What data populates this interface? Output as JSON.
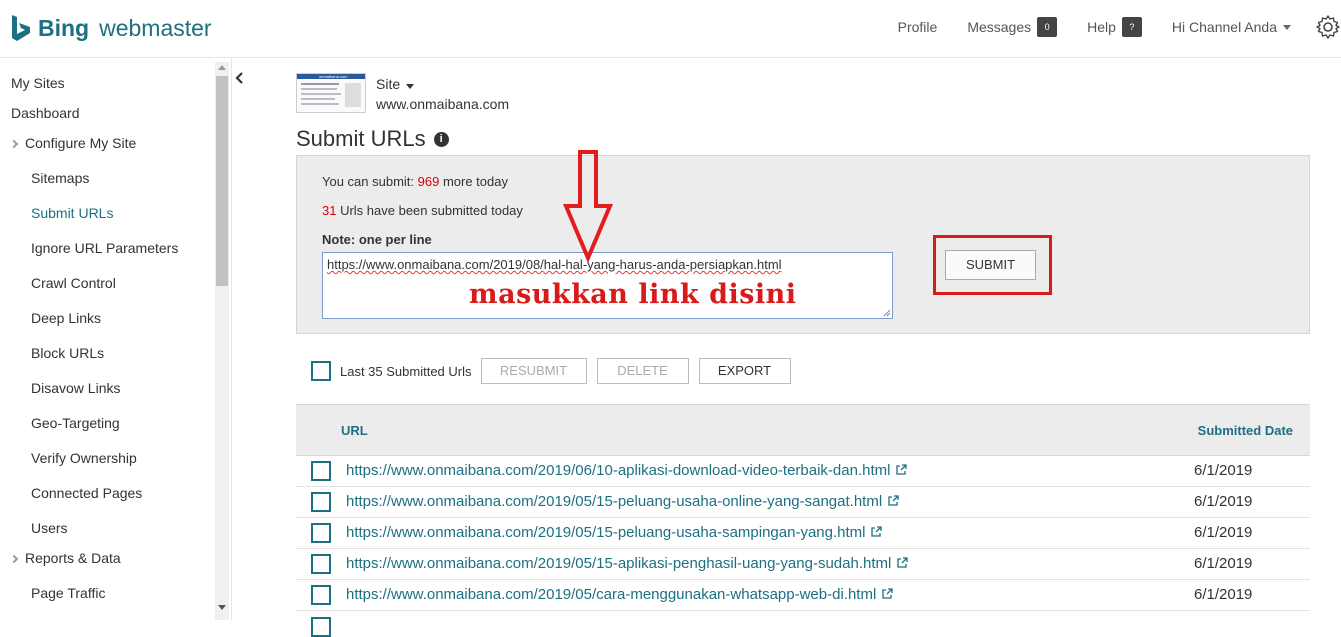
{
  "header": {
    "brand_bing": "Bing",
    "brand_product": "webmaster",
    "nav": {
      "profile": "Profile",
      "messages": "Messages",
      "messages_count": "0",
      "help": "Help",
      "help_badge": "?",
      "user": "Hi Channel Anda"
    }
  },
  "sidebar": {
    "items": [
      {
        "label": "My Sites"
      },
      {
        "label": "Dashboard"
      },
      {
        "label": "Configure My Site"
      },
      {
        "label": "Sitemaps"
      },
      {
        "label": "Submit URLs"
      },
      {
        "label": "Ignore URL Parameters"
      },
      {
        "label": "Crawl Control"
      },
      {
        "label": "Deep Links"
      },
      {
        "label": "Block URLs"
      },
      {
        "label": "Disavow Links"
      },
      {
        "label": "Geo-Targeting"
      },
      {
        "label": "Verify Ownership"
      },
      {
        "label": "Connected Pages"
      },
      {
        "label": "Users"
      },
      {
        "label": "Reports & Data"
      },
      {
        "label": "Page Traffic"
      }
    ],
    "active": "Submit URLs"
  },
  "site": {
    "label": "Site",
    "url": "www.onmaibana.com",
    "thumbnail_title": "onmaibana.com"
  },
  "page": {
    "title": "Submit URLs",
    "info_icon": "i"
  },
  "submit_panel": {
    "quota_prefix": "You can submit: ",
    "quota_value": "969",
    "quota_suffix": " more today",
    "submitted_value": "31",
    "submitted_suffix": " Urls have been submitted today",
    "note": "Note: one per line",
    "url_prefix": "https://www.onmaibana.com/2019/08/",
    "url_rest": "hal-hal-yang-harus-anda-persiapkan.html",
    "hint": "masukkan link disini",
    "submit_label": "SUBMIT"
  },
  "list_actions": {
    "select_all_label": "Last 35 Submitted Urls",
    "resubmit": "RESUBMIT",
    "delete": "DELETE",
    "export": "EXPORT"
  },
  "table": {
    "col_url": "URL",
    "col_date": "Submitted Date",
    "rows": [
      {
        "url": "https://www.onmaibana.com/2019/06/10-aplikasi-download-video-terbaik-dan.html",
        "date": "6/1/2019"
      },
      {
        "url": "https://www.onmaibana.com/2019/05/15-peluang-usaha-online-yang-sangat.html",
        "date": "6/1/2019"
      },
      {
        "url": "https://www.onmaibana.com/2019/05/15-peluang-usaha-sampingan-yang.html",
        "date": "6/1/2019"
      },
      {
        "url": "https://www.onmaibana.com/2019/05/15-aplikasi-penghasil-uang-yang-sudah.html",
        "date": "6/1/2019"
      },
      {
        "url": "https://www.onmaibana.com/2019/05/cara-menggunakan-whatsapp-web-di.html",
        "date": "6/1/2019"
      }
    ]
  },
  "colors": {
    "brand": "#1d6f82",
    "annotation_red": "#d91a1a",
    "count_red": "#dd0000"
  }
}
